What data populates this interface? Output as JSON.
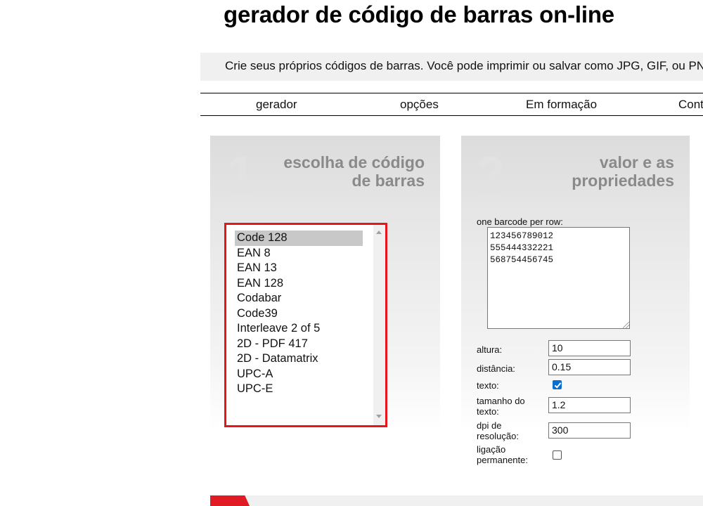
{
  "header": {
    "title": "gerador de código de barras on-line",
    "subtitle": "Crie seus próprios códigos de barras. Você pode imprimir ou salvar como JPG, GIF, ou PNG."
  },
  "nav": {
    "items": [
      "gerador",
      "opções",
      "Em formação",
      "Contato"
    ]
  },
  "panel1": {
    "number": "1",
    "heading_line1": "escolha de código",
    "heading_line2": "de barras",
    "barcode_types": [
      "Code 128",
      "EAN 8",
      "EAN 13",
      "EAN 128",
      "Codabar",
      "Code39",
      "Interleave 2 of 5",
      "2D - PDF 417",
      "2D - Datamatrix",
      "UPC-A",
      "UPC-E"
    ],
    "selected": "Code 128"
  },
  "panel2": {
    "number": "2",
    "heading_line1": "valor e as",
    "heading_line2": "propriedades",
    "rows_label": "one barcode per row:",
    "rows_value": "123456789012\n555444332221\n568754456745",
    "fields": {
      "altura": {
        "label": "altura:",
        "value": "10"
      },
      "distancia": {
        "label": "distância:",
        "value": "0.15"
      },
      "texto": {
        "label": "texto:",
        "checked": true
      },
      "tamanho_line1": "tamanho do",
      "tamanho_line2": "texto:",
      "tamanho_value": "1.2",
      "dpi_line1": "dpi de",
      "dpi_line2": "resolução:",
      "dpi_value": "300",
      "link_line1": "ligação",
      "link_line2": "permanente:",
      "link_checked": false
    }
  },
  "colors": {
    "highlight_border": "#e8141b",
    "checkbox_accent": "#0a6ed1",
    "heading_gray": "#8a8a8a"
  }
}
